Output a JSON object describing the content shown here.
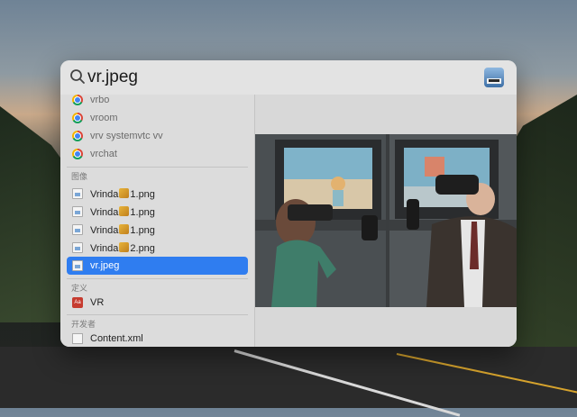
{
  "search": {
    "query": "vr.jpeg"
  },
  "results": {
    "items": [
      {
        "label": "vrbo",
        "icon": "chrome-icon"
      },
      {
        "label": "vroom",
        "icon": "chrome-icon"
      },
      {
        "label": "vrv systemvtc vv",
        "icon": "chrome-icon"
      },
      {
        "label": "vrchat",
        "icon": "chrome-icon"
      }
    ],
    "sections": {
      "images": "图像",
      "definitions": "定义",
      "developer": "开发者"
    },
    "image_files": [
      {
        "prefix": "Vrinda",
        "suffix": "1.png"
      },
      {
        "prefix": "Vrinda",
        "suffix": "1.png"
      },
      {
        "prefix": "Vrinda",
        "suffix": "1.png"
      },
      {
        "prefix": "Vrinda",
        "suffix": "2.png"
      }
    ],
    "selected": "vr.jpeg",
    "definition": "VR",
    "developer_item": "Content.xml"
  },
  "colors": {
    "selection": "#2f7df0",
    "panel": "#d8d8d8"
  }
}
